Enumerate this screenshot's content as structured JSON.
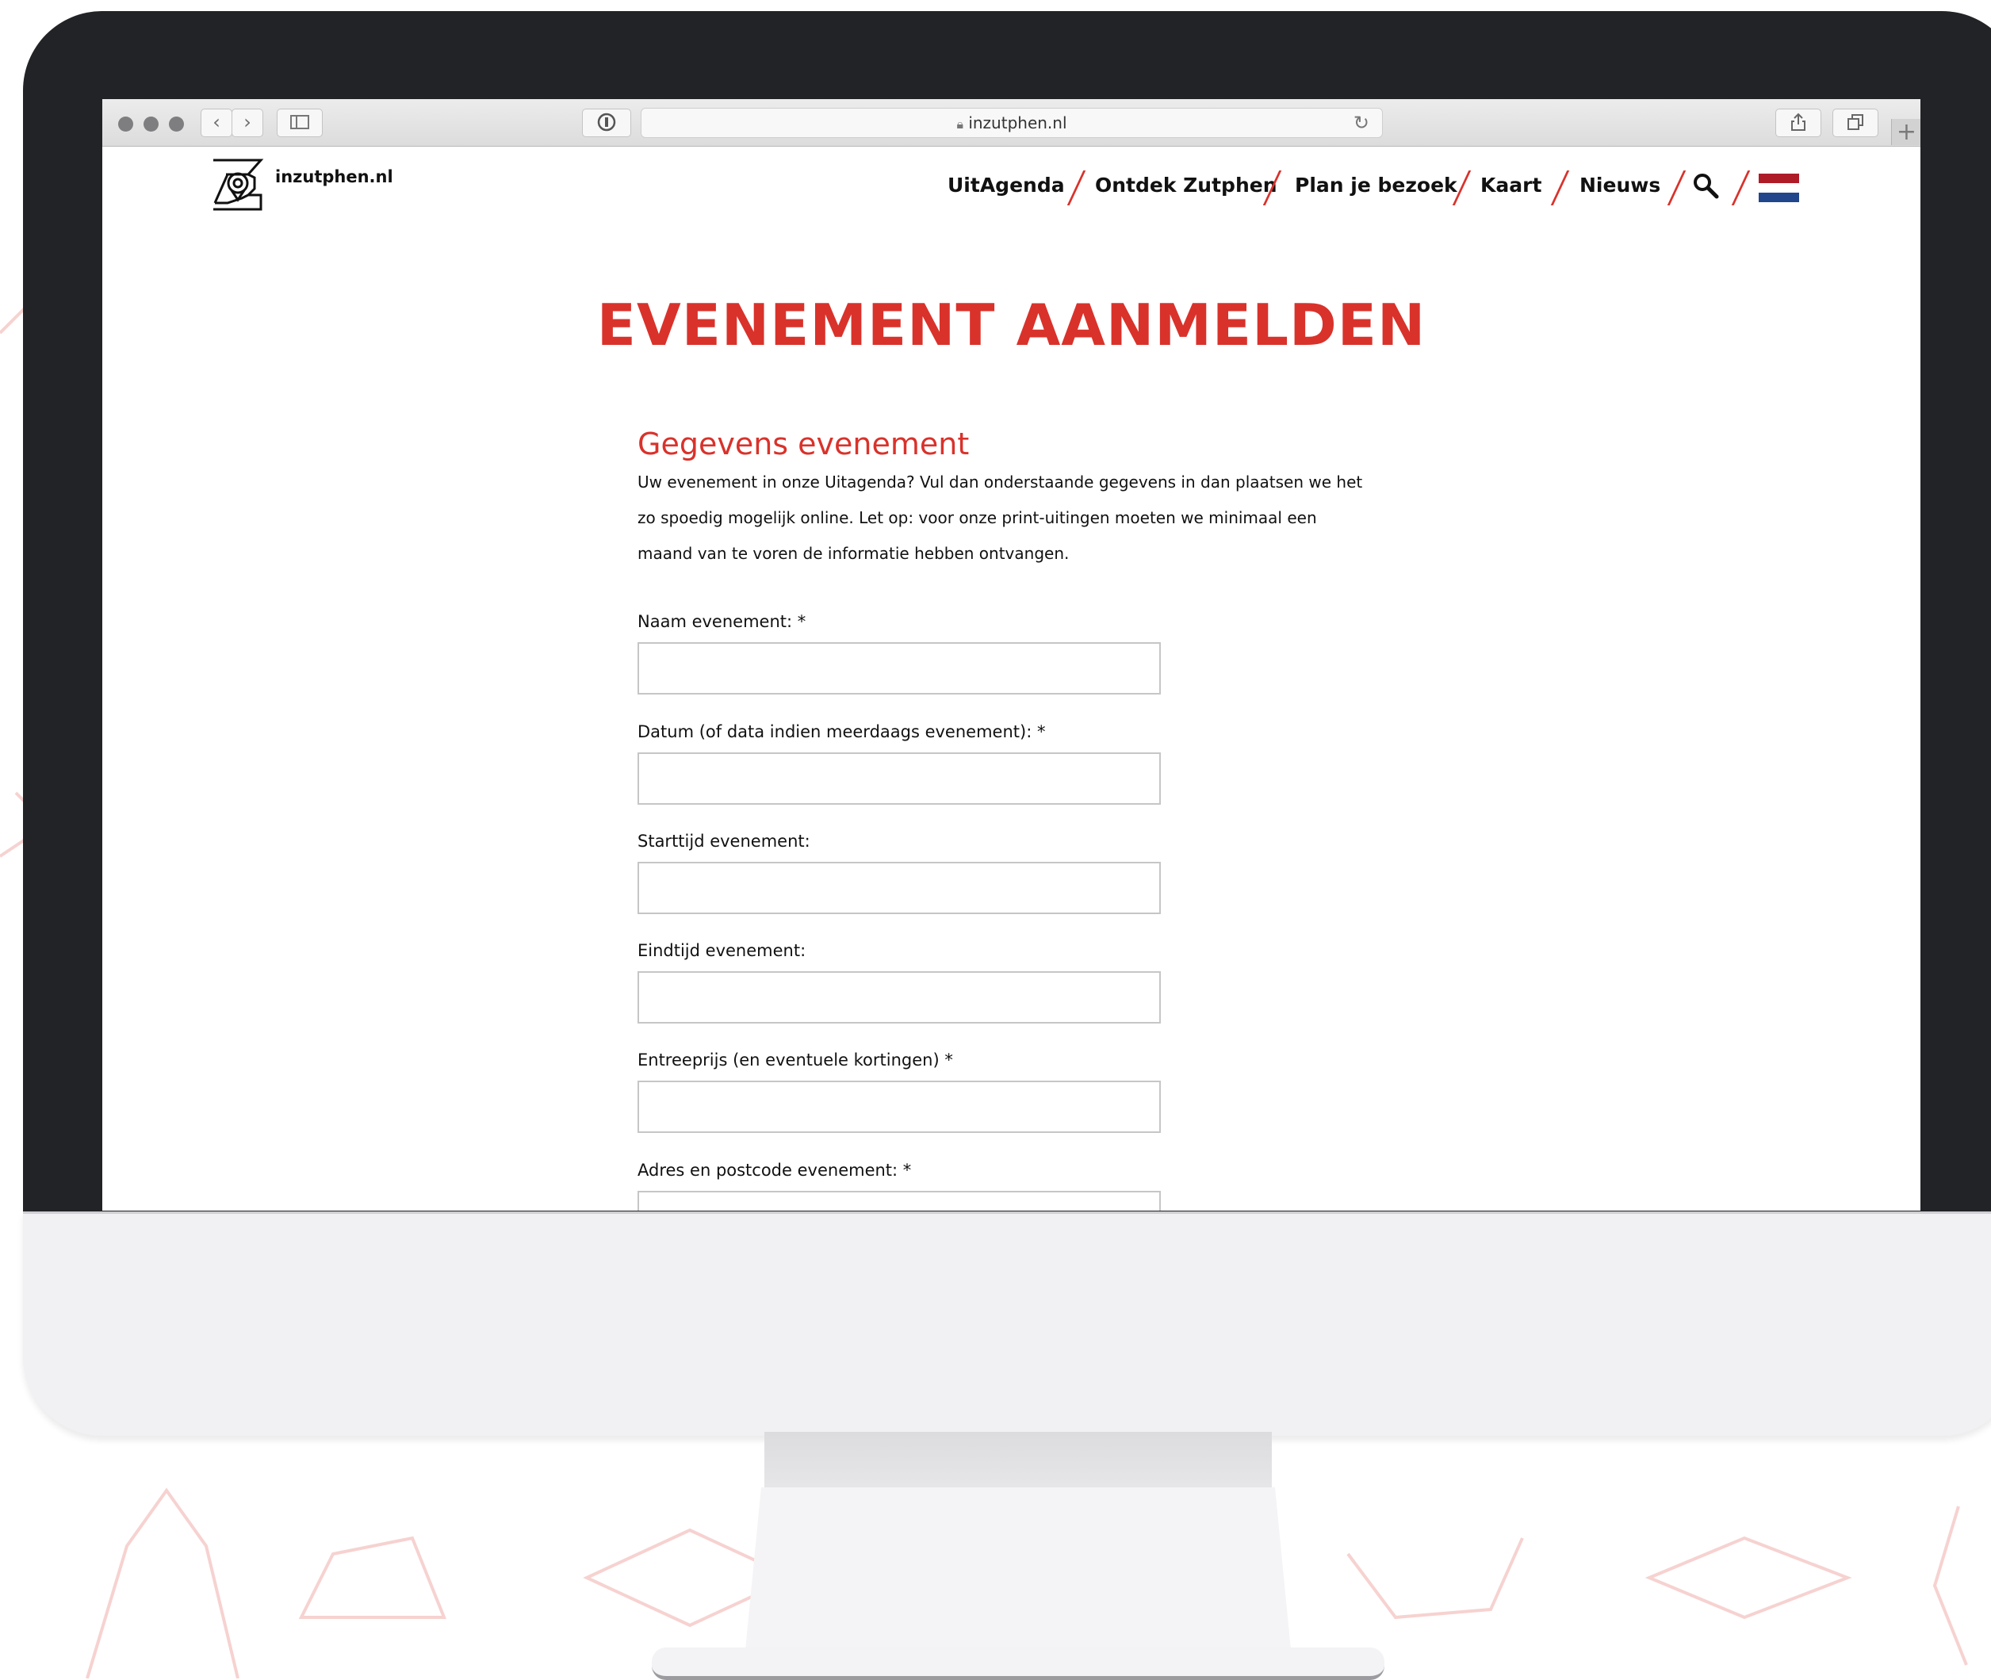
{
  "browser": {
    "url": "inzutphen.nl",
    "new_tab_symbol": "+"
  },
  "site": {
    "logo_text": "inzutphen.nl",
    "nav": [
      {
        "label": "UitAgenda"
      },
      {
        "label": "Ontdek Zutphen"
      },
      {
        "label": "Plan je bezoek"
      },
      {
        "label": "Kaart"
      },
      {
        "label": "Nieuws"
      }
    ],
    "language_flag": "netherlands-flag"
  },
  "page": {
    "title": "EVENEMENT AANMELDEN",
    "section_title": "Gegevens evenement",
    "intro_lines": [
      "Uw evenement in onze Uitagenda? Vul dan onderstaande gegevens in dan plaatsen we het",
      "zo spoedig mogelijk online. Let op: voor onze print-uitingen moeten we minimaal een",
      "maand van te voren de informatie hebben ontvangen."
    ],
    "fields": [
      {
        "label": "Naam evenement: *",
        "value": ""
      },
      {
        "label": "Datum (of data indien meerdaags evenement): *",
        "value": ""
      },
      {
        "label": "Starttijd evenement:",
        "value": ""
      },
      {
        "label": "Eindtijd evenement:",
        "value": ""
      },
      {
        "label": "Entreeprijs (en eventuele kortingen) *",
        "value": ""
      },
      {
        "label": "Adres en postcode evenement: *",
        "value": ""
      }
    ]
  },
  "colors": {
    "accent": "#d9322b",
    "bezel": "#222326",
    "flag": [
      "#ae1c28",
      "#ffffff",
      "#21468b"
    ]
  }
}
